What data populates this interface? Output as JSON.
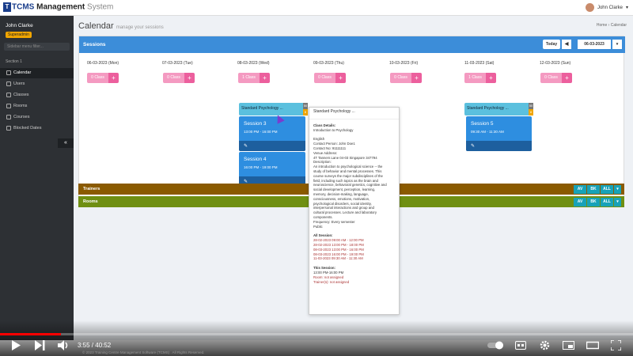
{
  "app": {
    "logo_badge": "T",
    "logo_name": "TCMS",
    "logo_word": "Management",
    "logo_sys": "System"
  },
  "top_user": {
    "name": "John Clarke",
    "caret": "▾"
  },
  "sidebar": {
    "user_name": "John Clarke",
    "role": "Superadmin",
    "search_placeholder": "Sidebar menu filter...",
    "section": "Section 1",
    "items": [
      {
        "label": "Calendar",
        "icon": "calendar-icon"
      },
      {
        "label": "Users",
        "icon": "users-icon"
      },
      {
        "label": "Classes",
        "icon": "external-link-icon"
      },
      {
        "label": "Rooms",
        "icon": "external-link-icon"
      },
      {
        "label": "Courses",
        "icon": "external-link-icon"
      },
      {
        "label": "Blocked Dates",
        "icon": "external-link-icon"
      }
    ],
    "collapse": "«"
  },
  "header": {
    "title": "Calendar",
    "subtitle": "manage your sessions",
    "crumb_home": "Home",
    "crumb_sep": "›",
    "crumb_current": "Calendar"
  },
  "panel": {
    "title": "Sessions",
    "today_label": "Today",
    "prev": "◀",
    "next": "▶",
    "date": "06-03-2023",
    "caret": "▾"
  },
  "days": [
    {
      "date": "06-03-2023 (Mon)",
      "count": "0 Class"
    },
    {
      "date": "07-03-2023 (Tue)",
      "count": "0 Class"
    },
    {
      "date": "08-03-2023 (Wed)",
      "count": "1 Class"
    },
    {
      "date": "09-03-2023 (Thu)",
      "count": "0 Class"
    },
    {
      "date": "10-03-2023 (Fri)",
      "count": "0 Class"
    },
    {
      "date": "11-03-2023 (Sat)",
      "count": "1 Class"
    },
    {
      "date": "12-03-2023 (Sun)",
      "count": "0 Class"
    }
  ],
  "plus": "+",
  "course_bars": [
    {
      "label": "Standard Psychology ...",
      "badge1": "50",
      "badge2": "8"
    },
    {
      "label": "Standard Psychology ...",
      "badge1": "50",
      "badge2": "8"
    }
  ],
  "sessions": [
    {
      "title": "Session 3",
      "time": "13:00 PM - 16:00 PM",
      "edit": "✎"
    },
    {
      "title": "Session 4",
      "time": "16:00 PM - 19:00 PM",
      "edit": "✎"
    },
    {
      "title": "Session 5",
      "time": "09:30 AM - 11:30 AM",
      "edit": "✎"
    }
  ],
  "rows": [
    {
      "label": "Trainers",
      "color": "#8a5a00",
      "b1": "AV",
      "b2": "BK",
      "b3": "ALL",
      "caret": "▾"
    },
    {
      "label": "Rooms",
      "color": "#6f8f12",
      "b1": "AV",
      "b2": "BK",
      "b3": "ALL",
      "caret": "▾"
    }
  ],
  "tooltip": {
    "heading": "Standard Psychology ...",
    "class_details": "Class Details:",
    "course": "Introduction to Psychology",
    "language": "English",
    "contact_person": "Contact Person: John Doe1",
    "contact_no": "Contact No: 91111111",
    "venue_label": "Venue Address:",
    "venue": "4T Tanners Lane 04-03 Singapore 347794",
    "desc_label": "Description:",
    "desc_lines": [
      "An introduction to psychological science -- the",
      "study of behavior and mental processes. This",
      "course surveys the major subdisciplines of the",
      "field, including such topics as the brain and",
      "neuroscience, behavioral genetics, cognitive and",
      "social development, perception, learning,",
      "memory, decision-making, language,",
      "consciousness, emotions, motivation,",
      "psychological disorders, social identity,",
      "interpersonal interactions and group and",
      "cultural processes. Lecture and laboratory",
      "components."
    ],
    "frequency": "Frequency: Every semester",
    "visibility": "Public",
    "all_label": "All Session:",
    "all_sessions": [
      "28-02-2023 09:00 AM - 12:00 PM",
      "28-02-2023 13:00 PM - 18:00 PM",
      "08-03-2023 13:00 PM - 16:00 PM",
      "08-03-2023 16:00 PM - 19:00 PM",
      "11-03-2023 09:30 AM - 11:30 AM"
    ],
    "this_label": "This Session:",
    "this_time": "13:00 PM-16:00 PM",
    "room": "Room: not assigned",
    "trainer": "Trainer(s): not assigned"
  },
  "video": {
    "time": "3:55 / 40:52",
    "progress_fraction": 0.096,
    "footer": "© 2023 Training Centre Management Software (TCMS) . All Rights Reserved."
  }
}
